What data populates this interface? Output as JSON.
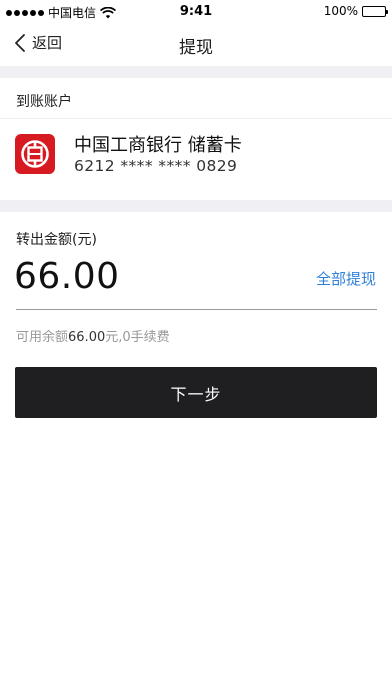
{
  "status_bar": {
    "carrier": "中国电信",
    "time": "9:41",
    "battery": "100%"
  },
  "nav": {
    "back_label": "返回",
    "title": "提现"
  },
  "account": {
    "section_label": "到账账户",
    "bank_name": "中国工商银行 储蓄卡",
    "card_number": "6212 **** **** 0829",
    "bank_logo_color": "#d71921"
  },
  "amount": {
    "label": "转出金额(元)",
    "value": "66.00",
    "withdraw_all": "全部提现",
    "available_prefix": "可用余额",
    "available_amount": "66.00",
    "available_suffix": "元,0手续费"
  },
  "actions": {
    "next_label": "下一步"
  },
  "colors": {
    "link": "#2f80d8",
    "button_bg": "#1f1f22",
    "section_gap": "#efeff4"
  }
}
